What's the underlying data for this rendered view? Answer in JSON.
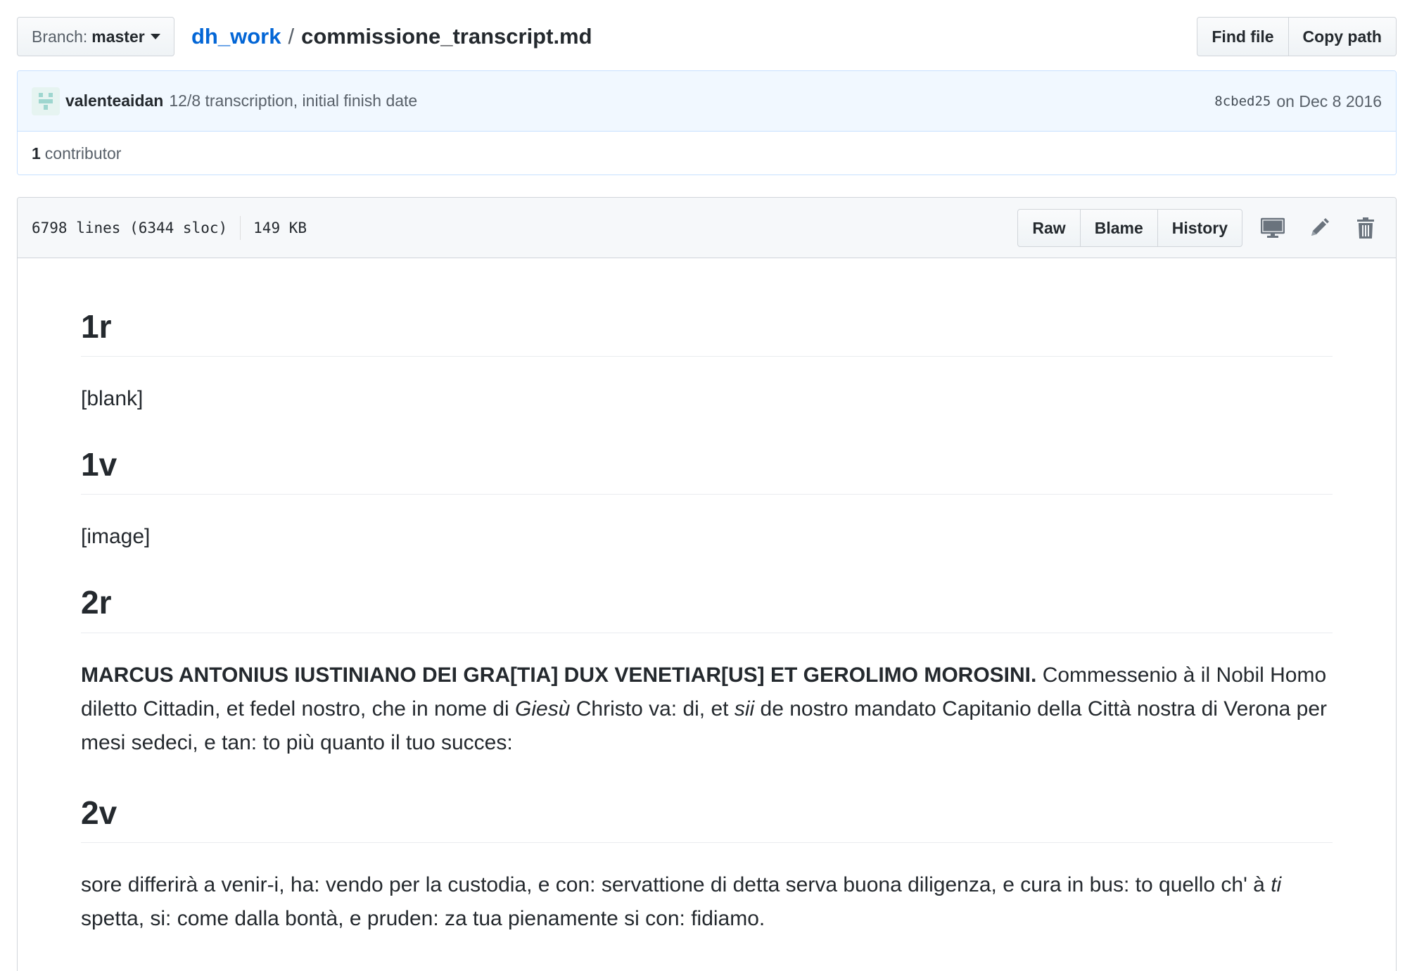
{
  "branch": {
    "label": "Branch:",
    "name": "master"
  },
  "breadcrumb": {
    "repo": "dh_work",
    "separator": "/",
    "file": "commissione_transcript.md"
  },
  "top_actions": {
    "find_file": "Find file",
    "copy_path": "Copy path"
  },
  "commit": {
    "author": "valenteaidan",
    "message": "12/8 transcription, initial finish date",
    "sha": "8cbed25",
    "date": "on Dec 8 2016"
  },
  "contributors": {
    "count": "1",
    "label": "contributor"
  },
  "file_header": {
    "lines": "6798 lines (6344 sloc)",
    "size": "149 KB",
    "raw": "Raw",
    "blame": "Blame",
    "history": "History"
  },
  "icons": {
    "desktop": "desktop-icon",
    "edit": "pencil-icon",
    "delete": "trash-icon",
    "avatar": "identicon"
  },
  "colors": {
    "link": "#0366d6",
    "commit_bg": "#f1f8ff",
    "commit_border": "#c8e1ff"
  },
  "content": {
    "sec1": {
      "heading": "1r",
      "text": "[blank]"
    },
    "sec2": {
      "heading": "1v",
      "text": "[image]"
    },
    "sec3": {
      "heading": "2r",
      "bold": "MARCUS ANTONIUS IUSTINIANO DEI GRA[TIA] DUX VENETIAR[US] ET GEROLIMO MOROSINI.",
      "t1": " Commessenio à il Nobil Homo diletto Cittadin, et fedel nostro, che in nome di ",
      "i1": "Giesù",
      "t2": " Christo va: di, et ",
      "i2": "sii",
      "t3": " de nostro mandato Capitanio della Città nostra di Verona per mesi sedeci, e tan: to più quanto il tuo succes:"
    },
    "sec4": {
      "heading": "2v",
      "t1": "sore differirà a venir-i, ha: vendo per la custodia, e con: servattione di detta serva buona diligenza, e cura in bus: to quello ch' à ",
      "i1": "ti",
      "t2": " spetta, si: come dalla bontà, e pruden: za tua pienamente si con: fidiamo."
    }
  }
}
